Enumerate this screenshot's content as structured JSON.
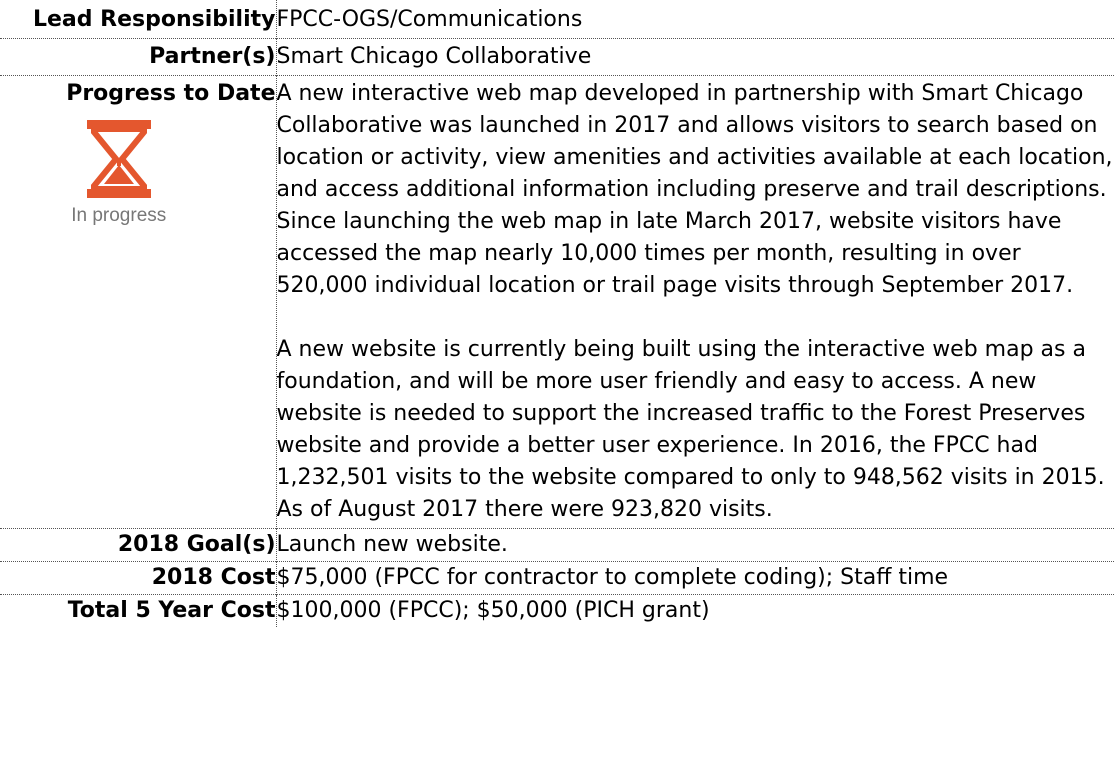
{
  "rows": {
    "lead": {
      "label": "Lead Responsibility",
      "value": "FPCC-OGS/Communications"
    },
    "partners": {
      "label": "Partner(s)",
      "value": "Smart Chicago Collaborative"
    },
    "progress": {
      "label": "Progress to Date",
      "status_text": "In progress",
      "status_icon": "hourglass-icon",
      "status_color": "#E4572E",
      "paragraphs": [
        "A new interactive web map developed in partnership with Smart Chicago Collaborative was launched in 2017 and allows visitors to search based on location or activity, view amenities and activities available at each location, and access additional information including preserve and trail descriptions. Since launching the web map in late March 2017, website visitors have accessed the map nearly 10,000 times per month, resulting in over 520,000 individual location or trail page visits through September 2017.",
        "A new website is currently being built using the interactive web map as a foundation, and will be more user friendly and easy to access. A new website is needed to support the increased traffic to the Forest Preserves website and provide a better user experience. In 2016, the FPCC had  1,232,501 visits to the website compared to only to  948,562 visits in 2015.  As of August 2017 there were 923,820 visits."
      ]
    },
    "goals": {
      "label": "2018 Goal(s)",
      "value": "Launch new website."
    },
    "cost": {
      "label": "2018 Cost",
      "value": "$75,000 (FPCC for contractor to complete coding); Staff time"
    },
    "total_cost": {
      "label": "Total 5 Year Cost",
      "value": "$100,000 (FPCC); $50,000 (PICH grant)"
    }
  }
}
